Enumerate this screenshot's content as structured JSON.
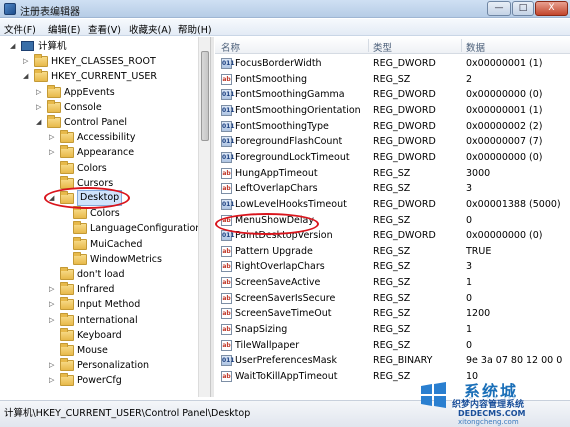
{
  "window": {
    "title": "注册表编辑器",
    "minimize_label": "—",
    "maximize_label": "□",
    "close_label": "X"
  },
  "menu": [
    "文件(F)",
    "编辑(E)",
    "查看(V)",
    "收藏夹(A)",
    "帮助(H)"
  ],
  "tree": [
    {
      "label": "计算机",
      "level": 0,
      "expanded": true,
      "icon": "computer-icon"
    },
    {
      "label": "HKEY_CLASSES_ROOT",
      "level": 1,
      "expanded": false,
      "icon": "folder-icon"
    },
    {
      "label": "HKEY_CURRENT_USER",
      "level": 1,
      "expanded": true,
      "icon": "folder-icon"
    },
    {
      "label": "AppEvents",
      "level": 2,
      "expanded": false,
      "icon": "folder-icon"
    },
    {
      "label": "Console",
      "level": 2,
      "expanded": false,
      "icon": "folder-icon"
    },
    {
      "label": "Control Panel",
      "level": 2,
      "expanded": true,
      "icon": "folder-icon"
    },
    {
      "label": "Accessibility",
      "level": 3,
      "expanded": false,
      "icon": "folder-icon"
    },
    {
      "label": "Appearance",
      "level": 3,
      "expanded": false,
      "icon": "folder-icon"
    },
    {
      "label": "Colors",
      "level": 3,
      "expanded": null,
      "icon": "folder-icon"
    },
    {
      "label": "Cursors",
      "level": 3,
      "expanded": null,
      "icon": "folder-icon"
    },
    {
      "label": "Desktop",
      "level": 3,
      "expanded": true,
      "selected": true,
      "icon": "folder-icon"
    },
    {
      "label": "Colors",
      "level": 4,
      "expanded": null,
      "icon": "folder-icon"
    },
    {
      "label": "LanguageConfiguration",
      "level": 4,
      "expanded": null,
      "icon": "folder-icon"
    },
    {
      "label": "MuiCached",
      "level": 4,
      "expanded": null,
      "icon": "folder-icon"
    },
    {
      "label": "WindowMetrics",
      "level": 4,
      "expanded": null,
      "icon": "folder-icon"
    },
    {
      "label": "don't load",
      "level": 3,
      "expanded": null,
      "icon": "folder-icon"
    },
    {
      "label": "Infrared",
      "level": 3,
      "expanded": false,
      "icon": "folder-icon"
    },
    {
      "label": "Input Method",
      "level": 3,
      "expanded": false,
      "icon": "folder-icon"
    },
    {
      "label": "International",
      "level": 3,
      "expanded": false,
      "icon": "folder-icon"
    },
    {
      "label": "Keyboard",
      "level": 3,
      "expanded": null,
      "icon": "folder-icon"
    },
    {
      "label": "Mouse",
      "level": 3,
      "expanded": null,
      "icon": "folder-icon"
    },
    {
      "label": "Personalization",
      "level": 3,
      "expanded": false,
      "icon": "folder-icon"
    },
    {
      "label": "PowerCfg",
      "level": 3,
      "expanded": false,
      "icon": "folder-icon"
    }
  ],
  "list": {
    "headers": {
      "name": "名称",
      "type": "类型",
      "data": "数据"
    },
    "rows": [
      {
        "name": "FocusBorderWidth",
        "type": "REG_DWORD",
        "data": "0x00000001 (1)",
        "kind": "dword"
      },
      {
        "name": "FontSmoothing",
        "type": "REG_SZ",
        "data": "2",
        "kind": "sz"
      },
      {
        "name": "FontSmoothingGamma",
        "type": "REG_DWORD",
        "data": "0x00000000 (0)",
        "kind": "dword"
      },
      {
        "name": "FontSmoothingOrientation",
        "type": "REG_DWORD",
        "data": "0x00000001 (1)",
        "kind": "dword"
      },
      {
        "name": "FontSmoothingType",
        "type": "REG_DWORD",
        "data": "0x00000002 (2)",
        "kind": "dword"
      },
      {
        "name": "ForegroundFlashCount",
        "type": "REG_DWORD",
        "data": "0x00000007 (7)",
        "kind": "dword"
      },
      {
        "name": "ForegroundLockTimeout",
        "type": "REG_DWORD",
        "data": "0x00000000 (0)",
        "kind": "dword"
      },
      {
        "name": "HungAppTimeout",
        "type": "REG_SZ",
        "data": "3000",
        "kind": "sz"
      },
      {
        "name": "LeftOverlapChars",
        "type": "REG_SZ",
        "data": "3",
        "kind": "sz"
      },
      {
        "name": "LowLevelHooksTimeout",
        "type": "REG_DWORD",
        "data": "0x00001388 (5000)",
        "kind": "dword"
      },
      {
        "name": "MenuShowDelay",
        "type": "REG_SZ",
        "data": "0",
        "kind": "sz"
      },
      {
        "name": "PaintDesktopVersion",
        "type": "REG_DWORD",
        "data": "0x00000000 (0)",
        "kind": "dword"
      },
      {
        "name": "Pattern Upgrade",
        "type": "REG_SZ",
        "data": "TRUE",
        "kind": "sz"
      },
      {
        "name": "RightOverlapChars",
        "type": "REG_SZ",
        "data": "3",
        "kind": "sz"
      },
      {
        "name": "ScreenSaveActive",
        "type": "REG_SZ",
        "data": "1",
        "kind": "sz"
      },
      {
        "name": "ScreenSaverIsSecure",
        "type": "REG_SZ",
        "data": "0",
        "kind": "sz"
      },
      {
        "name": "ScreenSaveTimeOut",
        "type": "REG_SZ",
        "data": "1200",
        "kind": "sz"
      },
      {
        "name": "SnapSizing",
        "type": "REG_SZ",
        "data": "1",
        "kind": "sz"
      },
      {
        "name": "TileWallpaper",
        "type": "REG_SZ",
        "data": "0",
        "kind": "sz"
      },
      {
        "name": "UserPreferencesMask",
        "type": "REG_BINARY",
        "data": "9e 3a 07 80 12 00 0",
        "kind": "dword"
      },
      {
        "name": "WaitToKillAppTimeout",
        "type": "REG_SZ",
        "data": "10",
        "kind": "sz"
      }
    ]
  },
  "icon_text": {
    "dword": "011",
    "sz": "ab"
  },
  "status": {
    "path": "计算机\\HKEY_CURRENT_USER\\Control Panel\\Desktop"
  },
  "watermark": {
    "brand": "系统城",
    "tagline": "织梦内容管理系统",
    "site": "DEDECMS.COM",
    "site2": "xitongcheng.com"
  },
  "colors": {
    "highlight_circle": "#d9141c",
    "selection": "#cfe3fb"
  }
}
